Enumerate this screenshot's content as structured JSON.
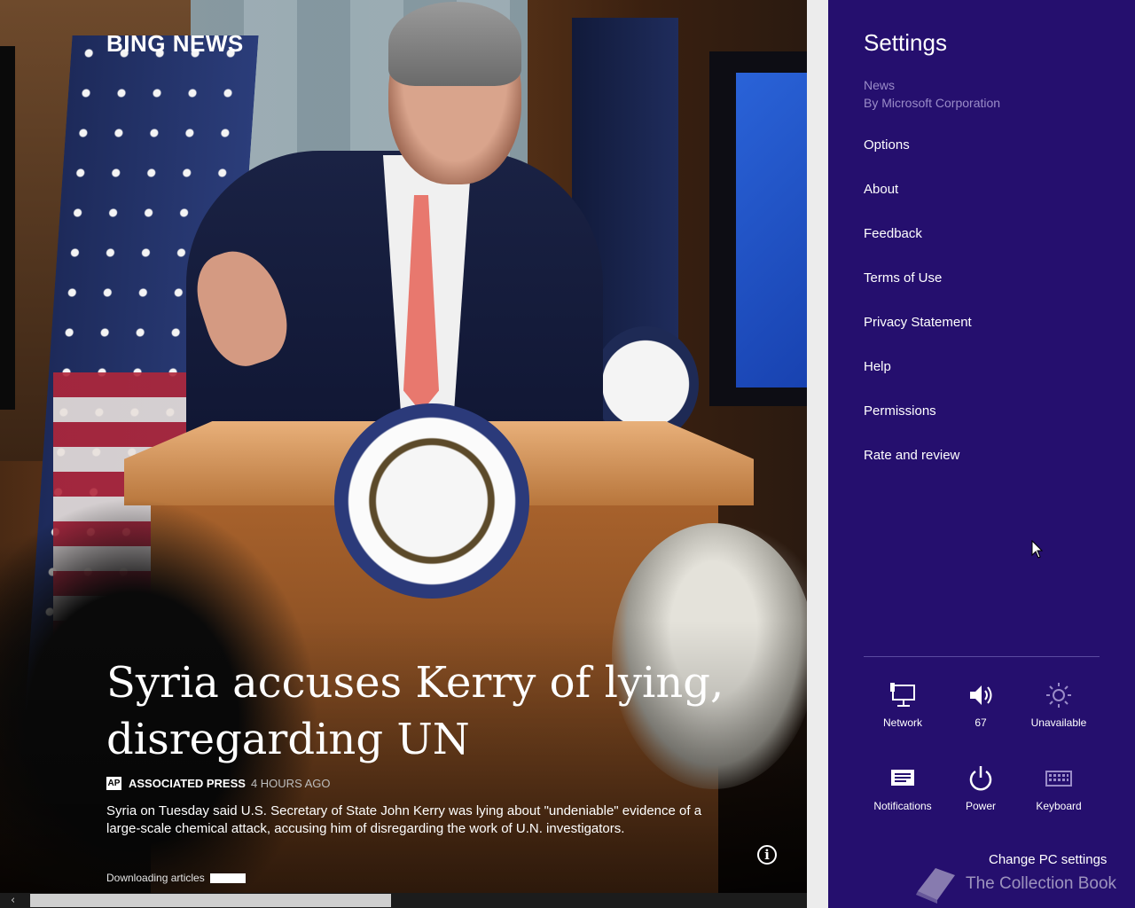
{
  "news": {
    "app_title": "BING NEWS",
    "headline": "Syria accuses Kerry of lying, disregarding UN",
    "source_badge": "AP",
    "source_name": "ASSOCIATED PRESS",
    "source_time": "4 HOURS AGO",
    "summary": "Syria on Tuesday said U.S. Secretary of State John Kerry was lying about \"undeniable\" evidence of a large-scale chemical attack, accusing him of disregarding the work of U.N. investigators.",
    "info_icon": "i",
    "download_label": "Downloading articles",
    "download_progress": 1.0,
    "scroll_arrow": "‹"
  },
  "settings": {
    "title": "Settings",
    "app_name": "News",
    "publisher": "By Microsoft Corporation",
    "menu": [
      {
        "label": "Options"
      },
      {
        "label": "About"
      },
      {
        "label": "Feedback"
      },
      {
        "label": "Terms of Use"
      },
      {
        "label": "Privacy Statement"
      },
      {
        "label": "Help"
      },
      {
        "label": "Permissions"
      },
      {
        "label": "Rate and review"
      }
    ],
    "quick": {
      "network": {
        "label": "Network",
        "icon": "network-icon"
      },
      "volume": {
        "label": "67",
        "icon": "volume-icon"
      },
      "brightness": {
        "label": "Unavailable",
        "icon": "brightness-icon"
      },
      "notifications": {
        "label": "Notifications",
        "icon": "notifications-icon"
      },
      "power": {
        "label": "Power",
        "icon": "power-icon"
      },
      "keyboard": {
        "label": "Keyboard",
        "icon": "keyboard-icon"
      }
    },
    "change_pc_settings": "Change PC settings"
  },
  "watermark": "The Collection Book",
  "colors": {
    "charm_bg": "#250f6e",
    "charm_secondary_text": "#9a8cc8"
  }
}
